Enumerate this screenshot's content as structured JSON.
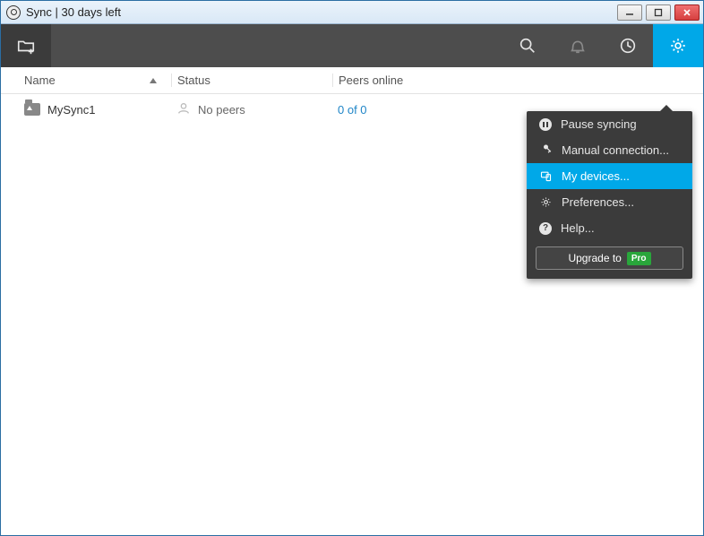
{
  "window": {
    "title": "Sync | 30 days left"
  },
  "columns": {
    "name": "Name",
    "status": "Status",
    "peers": "Peers online"
  },
  "rows": [
    {
      "name": "MySync1",
      "status": "No peers",
      "peers": "0 of 0"
    }
  ],
  "menu": {
    "pause": "Pause syncing",
    "manual": "Manual connection...",
    "devices": "My devices...",
    "prefs": "Preferences...",
    "help": "Help...",
    "upgrade_label": "Upgrade to",
    "upgrade_badge": "Pro"
  }
}
